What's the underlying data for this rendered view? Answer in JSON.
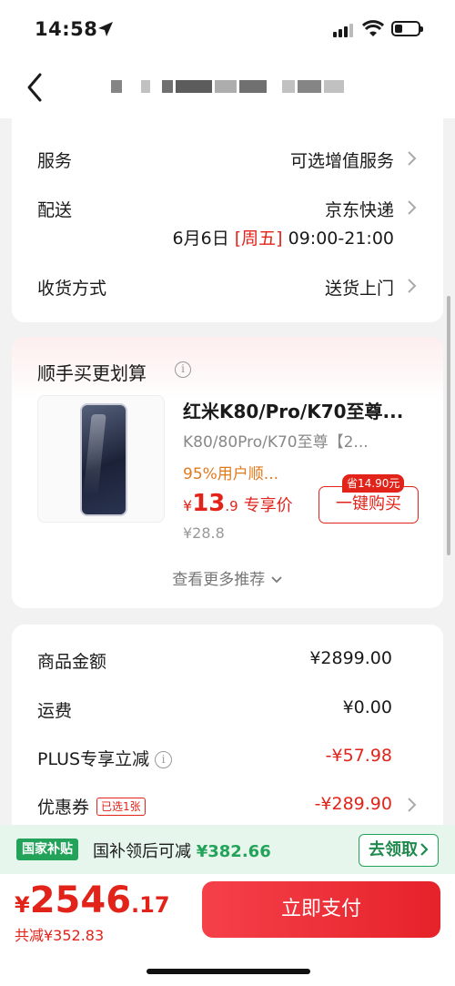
{
  "status_bar": {
    "time": "14:58"
  },
  "delivery": {
    "service_label": "服务",
    "service_value": "可选增值服务",
    "shipping_label": "配送",
    "shipping_value": "京东快递",
    "shipping_date": "6月6日",
    "shipping_weekday": "[周五]",
    "shipping_time": "09:00-21:00",
    "receive_label": "收货方式",
    "receive_value": "送货上门"
  },
  "recommend": {
    "title": "顺手买更划算",
    "product_name": "红米K80/Pro/K70至尊...",
    "product_sub": "K80/80Pro/K70至尊【2...",
    "product_tag": "95%用户顺...",
    "price_currency": "¥",
    "price_int": "13",
    "price_dec": ".9",
    "price_label": "专享价",
    "orig_price": "¥28.8",
    "save_badge": "省14.90元",
    "buy_label": "一键购买",
    "more_label": "查看更多推荐"
  },
  "summary": {
    "goods_label": "商品金额",
    "goods_value": "¥2899.00",
    "freight_label": "运费",
    "freight_value": "¥0.00",
    "plus_label": "PLUS专享立减",
    "plus_value": "-¥57.98",
    "coupon_label": "优惠券",
    "coupon_badge": "已选1张",
    "coupon_value": "-¥289.90"
  },
  "subsidy": {
    "tag": "国家补贴",
    "text": "国补领后可减",
    "amount": "¥382.66",
    "button": "去领取"
  },
  "checkout": {
    "currency": "¥",
    "total_int": "2546",
    "total_dec": ".17",
    "saved": "共减¥352.83",
    "pay_label": "立即支付"
  },
  "colors": {
    "accent_red": "#e2231a",
    "subsidy_green": "#23a35a",
    "orange": "#e07a1e"
  }
}
